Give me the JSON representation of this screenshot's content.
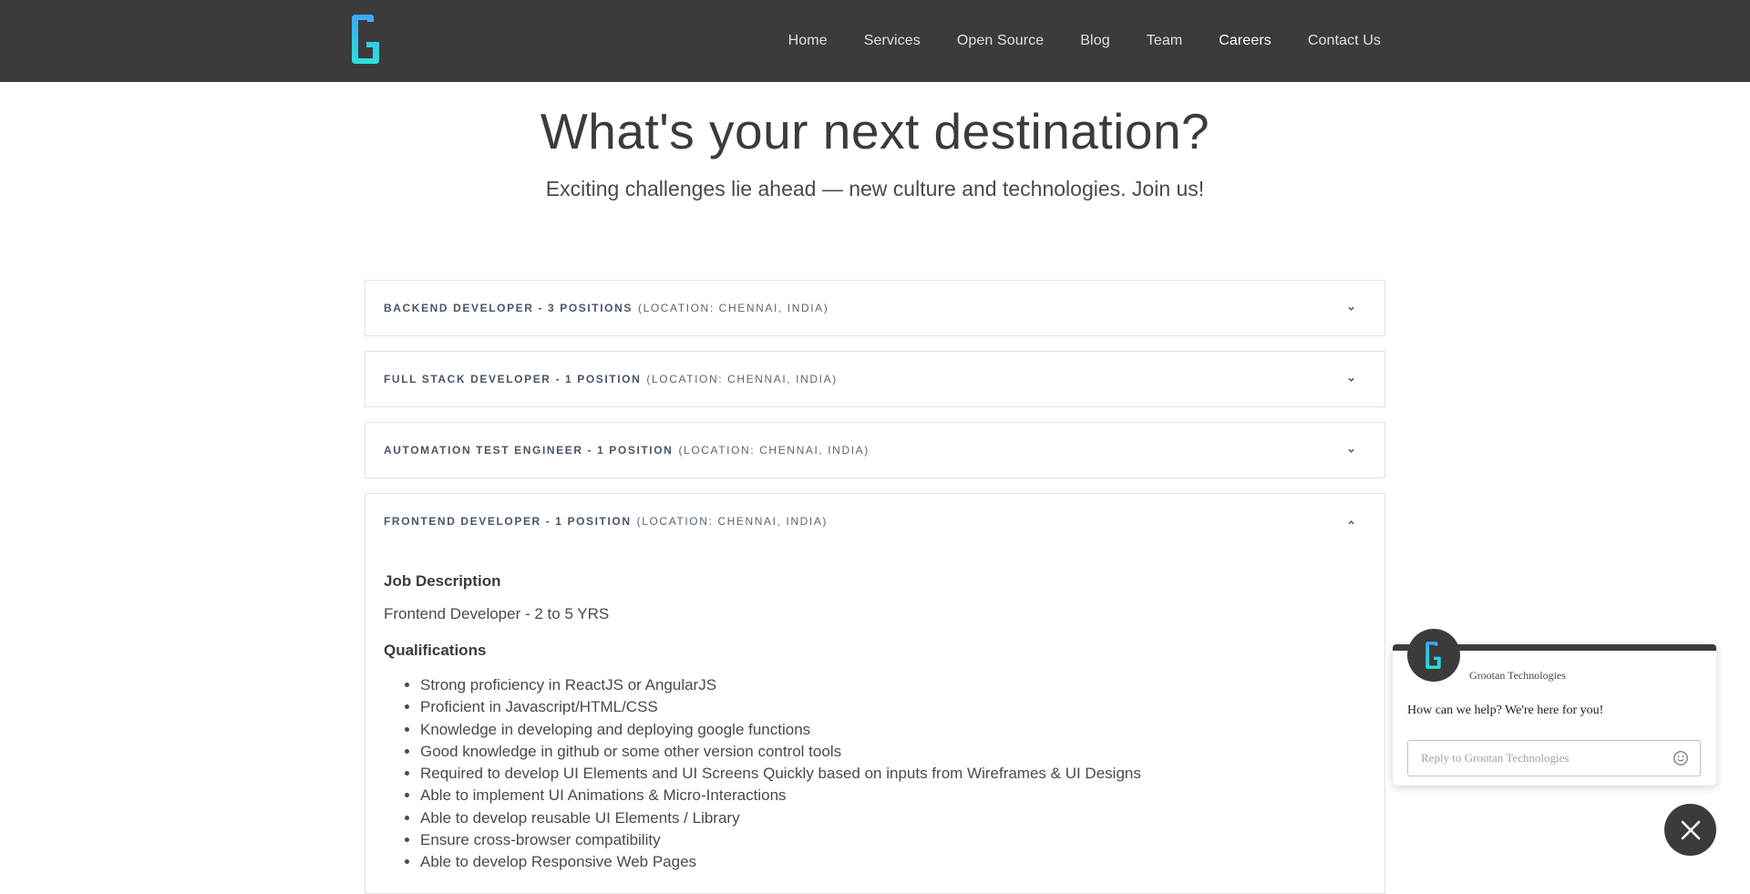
{
  "nav": {
    "items": [
      {
        "label": "Home"
      },
      {
        "label": "Services"
      },
      {
        "label": "Open Source"
      },
      {
        "label": "Blog"
      },
      {
        "label": "Team"
      },
      {
        "label": "Careers",
        "active": true
      },
      {
        "label": "Contact Us"
      }
    ]
  },
  "hero": {
    "title": "What's your next destination?",
    "subtitle": "Exciting challenges lie ahead — new culture and technologies. Join us!"
  },
  "jobs": [
    {
      "title": "Backend Developer - 3 Positions",
      "location": "(Location: Chennai, India)",
      "expanded": false
    },
    {
      "title": "Full Stack Developer - 1 Position",
      "location": "(Location: Chennai, India)",
      "expanded": false
    },
    {
      "title": "Automation Test Engineer - 1 Position",
      "location": "(Location: Chennai, India)",
      "expanded": false
    },
    {
      "title": "Frontend Developer - 1 Position",
      "location": "(Location: Chennai, India)",
      "expanded": true,
      "job_description_heading": "Job Description",
      "job_description_text": "Frontend Developer - 2 to 5 YRS",
      "qualifications_heading": "Qualifications",
      "qualifications": [
        "Strong proficiency in ReactJS or AngularJS",
        "Proficient in Javascript/HTML/CSS",
        "Knowledge in developing and deploying google functions",
        "Good knowledge in github or some other version control tools",
        "Required to develop UI Elements and UI Screens Quickly based on inputs from Wireframes & UI Designs",
        "Able to implement UI Animations & Micro-Interactions",
        "Able to develop reusable UI Elements / Library",
        "Ensure cross-browser compatibility",
        "Able to develop Responsive Web Pages"
      ]
    }
  ],
  "chat": {
    "company_name": "Grootan Technologies",
    "message": "How can we help? We're here for you!",
    "input_placeholder": "Reply to Grootan Technologies"
  },
  "colors": {
    "header_bg": "#3b3b3b",
    "logo_gradient_top": "#37b7f5",
    "logo_gradient_bottom": "#2ee6d6"
  },
  "icons": {
    "logo": "grootan-g-logo",
    "chevron_down": "chevron-down-icon",
    "chevron_up": "chevron-up-icon",
    "emoji": "emoji-icon",
    "close": "close-icon"
  }
}
